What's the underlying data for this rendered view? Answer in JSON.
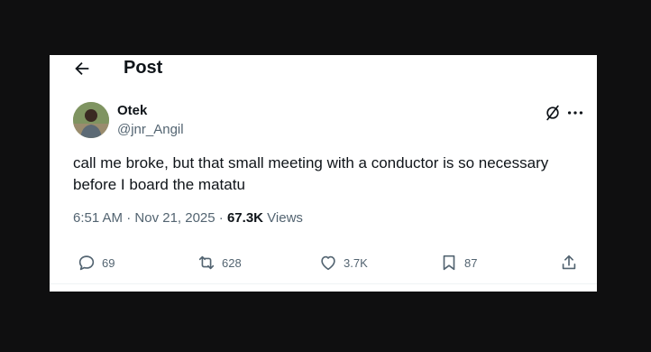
{
  "header": {
    "title": "Post"
  },
  "author": {
    "name": "Otek",
    "handle": "@jnr_Angil"
  },
  "post": {
    "text": "call me broke, but that small meeting with a conductor is so necessary before I board the matatu",
    "time": "6:51 AM",
    "date": "Nov 21, 2025",
    "views_count": "67.3K",
    "views_label": "Views"
  },
  "actions": {
    "replies": "69",
    "reposts": "628",
    "likes": "3.7K",
    "bookmarks": "87"
  },
  "icons": [
    "back-arrow-icon",
    "grok-icon",
    "more-icon",
    "reply-icon",
    "repost-icon",
    "like-icon",
    "bookmark-icon",
    "share-icon"
  ]
}
